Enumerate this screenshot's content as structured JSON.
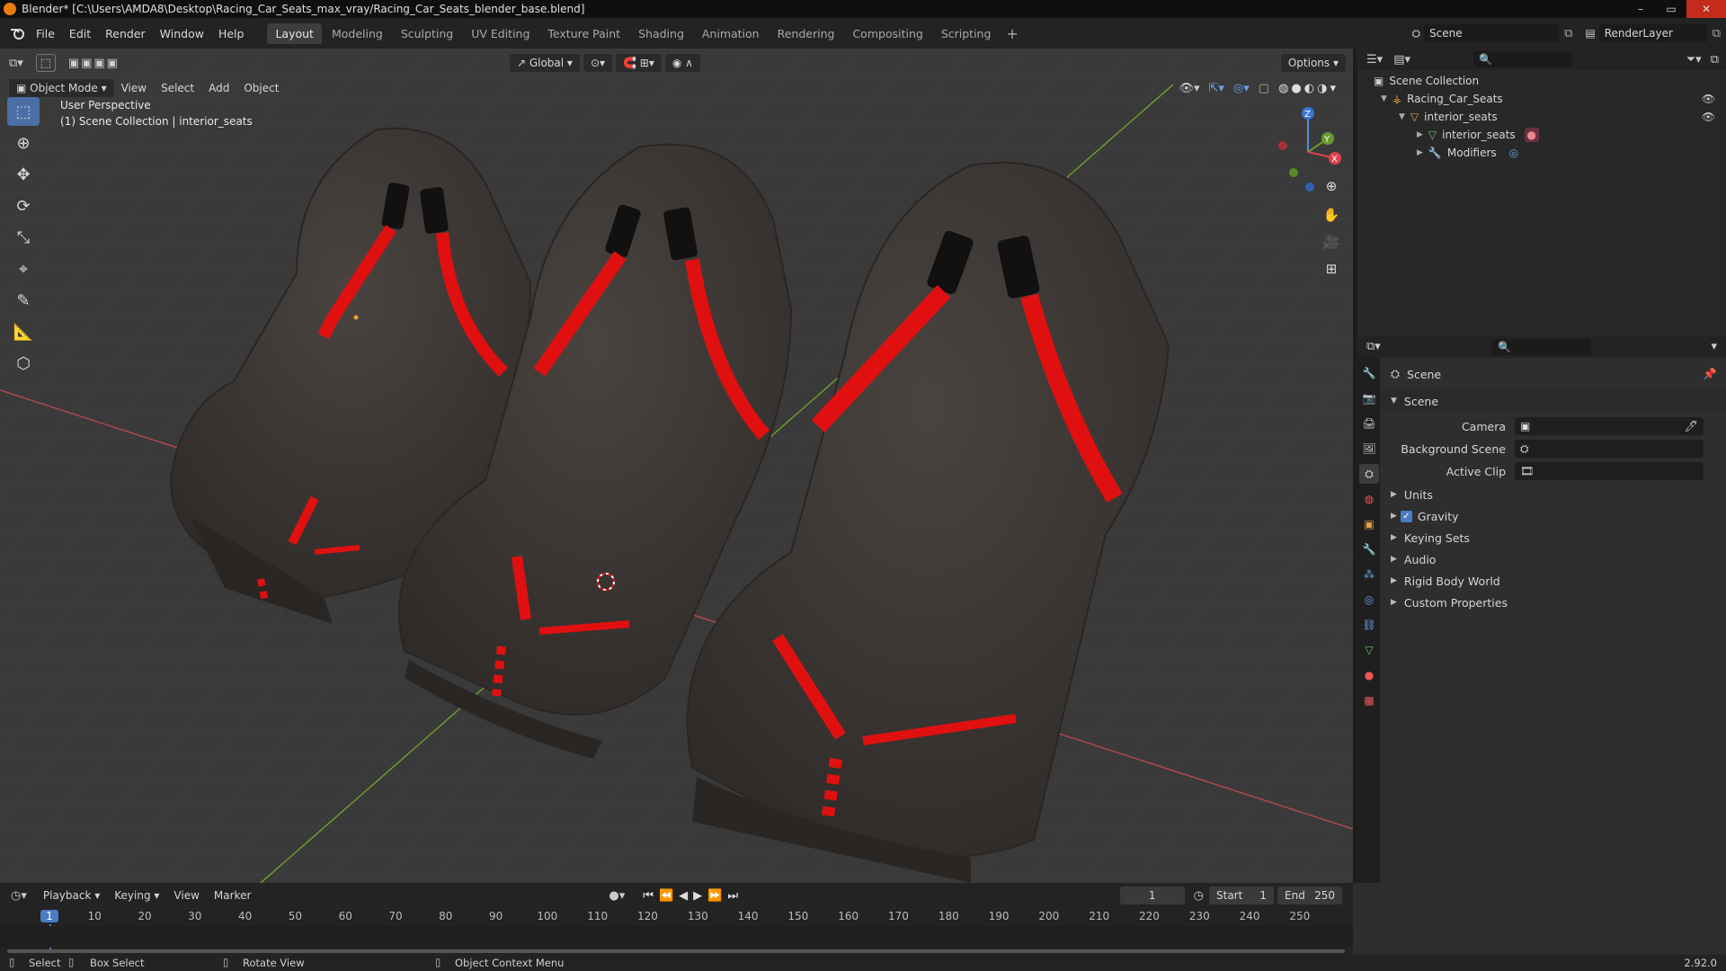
{
  "window": {
    "title": "Blender* [C:\\Users\\AMDA8\\Desktop\\Racing_Car_Seats_max_vray/Racing_Car_Seats_blender_base.blend]",
    "controls": [
      "–",
      "▭",
      "✕"
    ]
  },
  "menubar": [
    "File",
    "Edit",
    "Render",
    "Window",
    "Help"
  ],
  "workspaces": [
    "Layout",
    "Modeling",
    "Sculpting",
    "UV Editing",
    "Texture Paint",
    "Shading",
    "Animation",
    "Rendering",
    "Compositing",
    "Scripting"
  ],
  "active_workspace": "Layout",
  "scene_field": "Scene",
  "renderlayer_field": "RenderLayer",
  "viewport": {
    "transform_orientation": "Global",
    "options_label": "Options",
    "mode": "Object Mode",
    "menus": [
      "View",
      "Select",
      "Add",
      "Object"
    ],
    "info_line1": "User Perspective",
    "info_line2": "(1) Scene Collection | interior_seats",
    "gizmo_axes": [
      "Z",
      "Y",
      "X"
    ]
  },
  "outliner": {
    "root": "Scene Collection",
    "items": [
      {
        "label": "Racing_Car_Seats",
        "depth": 1,
        "expanded": true
      },
      {
        "label": "interior_seats",
        "depth": 2,
        "expanded": true
      },
      {
        "label": "interior_seats",
        "depth": 3,
        "expanded": false
      },
      {
        "label": "Modifiers",
        "depth": 3,
        "expanded": false
      }
    ]
  },
  "properties": {
    "context": "Scene",
    "panel": "Scene",
    "fields": [
      {
        "label": "Camera",
        "value": ""
      },
      {
        "label": "Background Scene",
        "value": ""
      },
      {
        "label": "Active Clip",
        "value": ""
      }
    ],
    "subpanels": [
      "Units",
      "Gravity",
      "Keying Sets",
      "Audio",
      "Rigid Body World",
      "Custom Properties"
    ],
    "gravity_checked": true
  },
  "timeline": {
    "menus": [
      "Playback",
      "Keying",
      "View",
      "Marker"
    ],
    "current_frame": "1",
    "start_label": "Start",
    "start_value": "1",
    "end_label": "End",
    "end_value": "250",
    "ticks": [
      "1",
      "10",
      "20",
      "30",
      "40",
      "50",
      "60",
      "70",
      "80",
      "90",
      "100",
      "110",
      "120",
      "130",
      "140",
      "150",
      "160",
      "170",
      "180",
      "190",
      "200",
      "210",
      "220",
      "230",
      "240",
      "250"
    ]
  },
  "statusbar": {
    "select": "Select",
    "box_select": "Box Select",
    "rotate_view": "Rotate View",
    "context_menu": "Object Context Menu",
    "version": "2.92.0"
  },
  "colors": {
    "accent": "#4a6ea5",
    "belt_red": "#e01010",
    "seat_dark": "#3f3a37",
    "x_axis": "#b0474f",
    "y_axis": "#6b9a2c",
    "frame_marker": "#4a7cc4"
  }
}
